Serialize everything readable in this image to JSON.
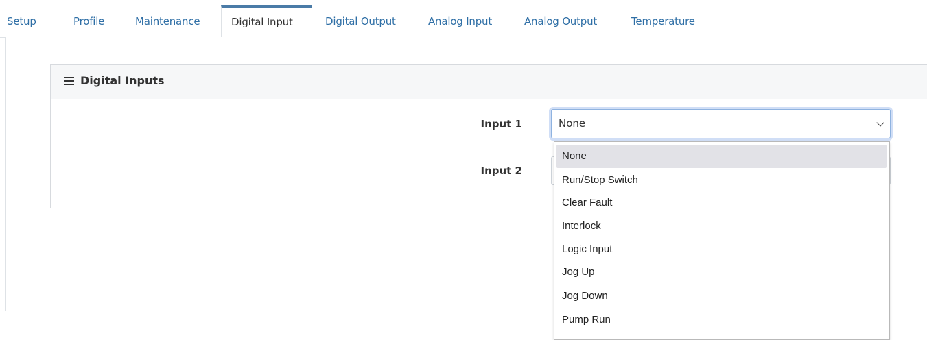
{
  "tabs": [
    {
      "label": "Setup"
    },
    {
      "label": "Profile"
    },
    {
      "label": "Maintenance"
    },
    {
      "label": "Digital Input"
    },
    {
      "label": "Digital Output"
    },
    {
      "label": "Analog Input"
    },
    {
      "label": "Analog Output"
    },
    {
      "label": "Temperature"
    }
  ],
  "active_tab": "Digital Input",
  "card": {
    "title": "Digital Inputs",
    "icon": "hamburger-menu-icon"
  },
  "inputs": [
    {
      "label": "Input 1",
      "value": "None"
    },
    {
      "label": "Input 2",
      "value": ""
    }
  ],
  "dropdown": {
    "options": [
      "None",
      "Run/Stop Switch",
      "Clear Fault",
      "Interlock",
      "Logic Input",
      "Jog Up",
      "Jog Down",
      "Pump Run"
    ],
    "selected": "None"
  },
  "colors": {
    "tab_link": "#2f6fa6",
    "active_tab_border": "#4a7ba7",
    "focus_ring": "#8fb3e0",
    "selected_option": "#e2e2e7"
  }
}
